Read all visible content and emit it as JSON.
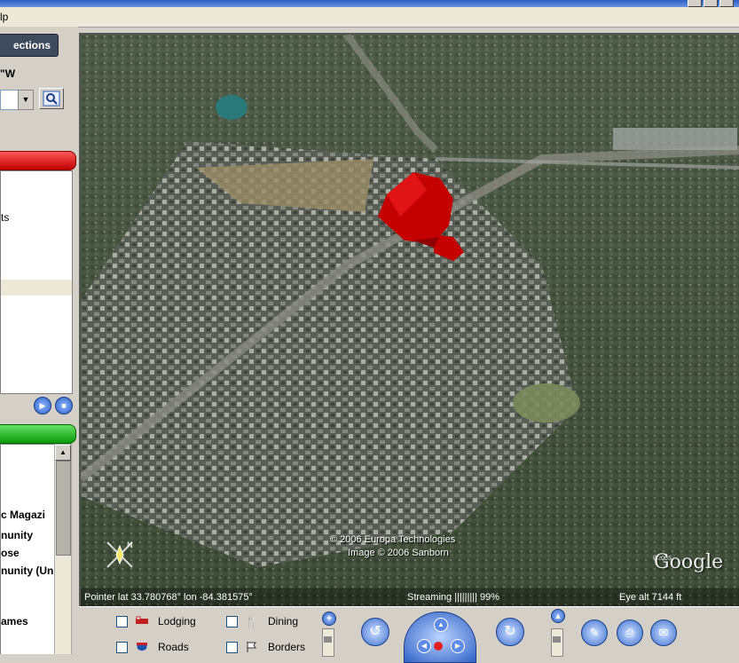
{
  "menubar": {
    "help_fragment": "lp"
  },
  "left_panel": {
    "directions_tab": "ections",
    "coordinate_fragment": "\"W",
    "results": [
      {
        "text": "ts"
      }
    ],
    "layers": [
      {
        "text": "c Magazi"
      },
      {
        "text": "nunity"
      },
      {
        "text": "ose"
      },
      {
        "text": "nunity (Un"
      },
      {
        "text": "ames"
      }
    ]
  },
  "map": {
    "copyright_1": "© 2006 Europa Technologies",
    "copyright_2": "Image © 2006 Sanborn",
    "google_logo": "Google",
    "google_year": "©2005",
    "status": {
      "pointer": "Pointer lat  33.780768°  lon  -84.381575°",
      "streaming": "Streaming ||||||||| 99%",
      "eye_alt": "Eye  alt    7144 ft"
    },
    "compass_letter": "N"
  },
  "controls": {
    "layers": [
      {
        "label": "Lodging",
        "checked": false
      },
      {
        "label": "Dining",
        "checked": false
      },
      {
        "label": "Roads",
        "checked": false
      },
      {
        "label": "Borders",
        "checked": false
      }
    ]
  },
  "colors": {
    "red_bar": "#d40000",
    "green_bar": "#13a613",
    "nav_blue": "#2f62c4",
    "marker_red": "#c40000"
  }
}
